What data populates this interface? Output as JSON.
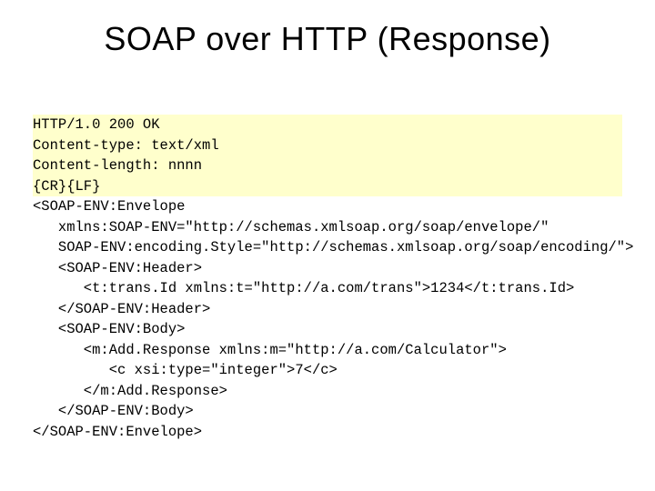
{
  "title": "SOAP over HTTP (Response)",
  "code": {
    "l1": "HTTP/1.0 200 OK",
    "l2": "Content-type: text/xml",
    "l3": "Content-length: nnnn",
    "l4": "{CR}{LF}",
    "l5": "<SOAP-ENV:Envelope",
    "l6": "   xmlns:SOAP-ENV=\"http://schemas.xmlsoap.org/soap/envelope/\"",
    "l7": "   SOAP-ENV:encoding.Style=\"http://schemas.xmlsoap.org/soap/encoding/\">",
    "l8": "   <SOAP-ENV:Header>",
    "l9": "      <t:trans.Id xmlns:t=\"http://a.com/trans\">1234</t:trans.Id>",
    "l10": "   </SOAP-ENV:Header>",
    "l11": "   <SOAP-ENV:Body>",
    "l12": "      <m:Add.Response xmlns:m=\"http://a.com/Calculator\">",
    "l13": "         <c xsi:type=\"integer\">7</c>",
    "l14": "      </m:Add.Response>",
    "l15": "   </SOAP-ENV:Body>",
    "l16": "</SOAP-ENV:Envelope>"
  }
}
